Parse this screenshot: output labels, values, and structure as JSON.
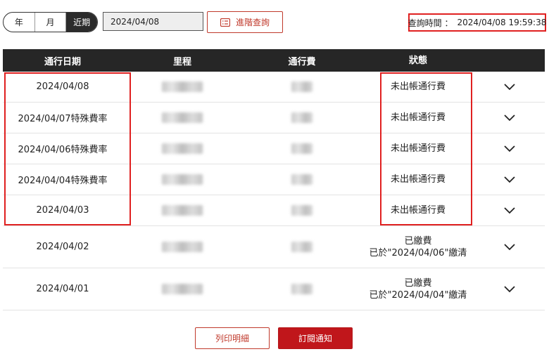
{
  "period_tabs": [
    {
      "label": "年",
      "active": false
    },
    {
      "label": "月",
      "active": false
    },
    {
      "label": "近期",
      "active": true
    }
  ],
  "date_input": {
    "value": "2024/04/08"
  },
  "advanced_search": {
    "label": "進階查詢",
    "icon": "search-list-icon"
  },
  "query_time": {
    "label": "查詢時間 ：",
    "value": "2024/04/08 19:59:38"
  },
  "table": {
    "columns": [
      "通行日期",
      "里程",
      "通行費",
      "狀態"
    ],
    "rows": [
      {
        "date": "2024/04/08",
        "status_line1": "未出帳通行費",
        "status_line2": ""
      },
      {
        "date": "2024/04/07特殊費率",
        "status_line1": "未出帳通行費",
        "status_line2": ""
      },
      {
        "date": "2024/04/06特殊費率",
        "status_line1": "未出帳通行費",
        "status_line2": ""
      },
      {
        "date": "2024/04/04特殊費率",
        "status_line1": "未出帳通行費",
        "status_line2": ""
      },
      {
        "date": "2024/04/03",
        "status_line1": "未出帳通行費",
        "status_line2": ""
      },
      {
        "date": "2024/04/02",
        "status_line1": "已繳費",
        "status_line2": "已於\"2024/04/06\"繳清"
      },
      {
        "date": "2024/04/01",
        "status_line1": "已繳費",
        "status_line2": "已於\"2024/04/04\"繳清"
      }
    ]
  },
  "buttons": {
    "print": "列印明細",
    "subscribe": "訂閱通知"
  },
  "colors": {
    "accent": "#c0161b",
    "highlight": "#e02020",
    "header_bg": "#262626"
  }
}
